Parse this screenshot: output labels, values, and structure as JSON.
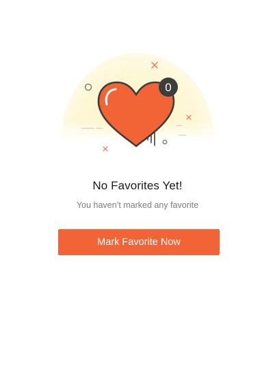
{
  "empty_state": {
    "badge_count": "0",
    "title": "No Favorites Yet!",
    "subtitle": "You haven’t marked any favorite",
    "button_label": "Mark Favorite Now"
  },
  "colors": {
    "accent": "#f26436",
    "heart": "#f26436",
    "heart_outline": "#3d3d3d",
    "badge": "#3d3d3d",
    "glow": "#fdf6c8",
    "sparkle": "#f0705a"
  },
  "icons": {
    "illustration": "heart-icon",
    "badge": "count-badge",
    "decor": [
      "sparkle-icon",
      "circle-dot-icon"
    ]
  }
}
